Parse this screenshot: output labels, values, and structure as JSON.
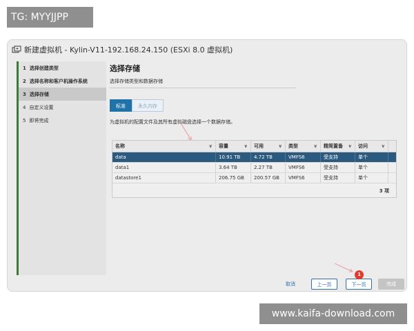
{
  "watermark_top": "TG: MYYJJPP",
  "watermark_bottom": "www.kaifa-download.com",
  "window": {
    "title": "新建虚拟机 - Kylin-V11-192.168.24.150 (ESXi 8.0 虚拟机)",
    "icon": "vm-new-icon"
  },
  "steps": [
    {
      "num": "1",
      "label": "选择创建类型"
    },
    {
      "num": "2",
      "label": "选择名称和客户机操作系统"
    },
    {
      "num": "3",
      "label": "选择存储"
    },
    {
      "num": "4",
      "label": "自定义设置"
    },
    {
      "num": "5",
      "label": "即将完成"
    }
  ],
  "page": {
    "title": "选择存储",
    "subtitle": "选择存储类型和数据存储",
    "tabs": [
      "标准",
      "永久内存"
    ],
    "description": "为虚拟机的配置文件及其所有虚拟磁盘选择一个数据存储。"
  },
  "table": {
    "headers": [
      "名称",
      "容量",
      "可用",
      "类型",
      "精简置备",
      "访问"
    ],
    "rows": [
      [
        "data",
        "10.91 TB",
        "4.72 TB",
        "VMFS6",
        "受支持",
        "单个"
      ],
      [
        "data1",
        "3.64 TB",
        "2.27 TB",
        "VMFS6",
        "受支持",
        "单个"
      ],
      [
        "datastore1",
        "206.75 GB",
        "200.57 GB",
        "VMFS6",
        "受支持",
        "单个"
      ]
    ],
    "count": "3 项"
  },
  "buttons": {
    "cancel": "取消",
    "prev": "上一页",
    "next": "下一页",
    "finish": "完成"
  },
  "annotation_badge": "1",
  "colors": {
    "accent": "#1f73a8",
    "selected_row": "#2b5a7e",
    "sidebar_bar": "#3d7a3a",
    "badge": "#e23b2e",
    "annotation_arrow": "#e8a8a8"
  }
}
